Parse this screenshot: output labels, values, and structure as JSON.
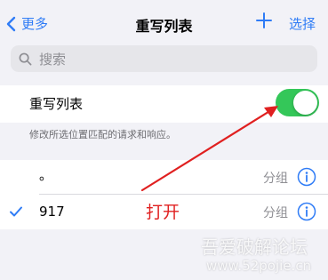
{
  "nav": {
    "back_label": "更多",
    "title": "重写列表",
    "select_label": "选择"
  },
  "search": {
    "placeholder": "搜索"
  },
  "toggle": {
    "label": "重写列表",
    "on": true
  },
  "description": "修改所选位置匹配的请求和响应。",
  "rules": [
    {
      "name": "。",
      "group": "分组",
      "checked": false
    },
    {
      "name": "917",
      "group": "分组",
      "checked": true
    }
  ],
  "annotation": "打开",
  "watermark": {
    "line1": "吾爱破解论坛",
    "line2": "www.52pojie.cn"
  },
  "colors": {
    "accent": "#2f7cf6",
    "switch_on": "#34c759",
    "annotation": "#e02020"
  },
  "icons": {
    "back": "chevron-left-icon",
    "add": "plus-icon",
    "search": "magnifier-icon",
    "info": "info-circle-icon",
    "check": "checkmark-icon"
  }
}
